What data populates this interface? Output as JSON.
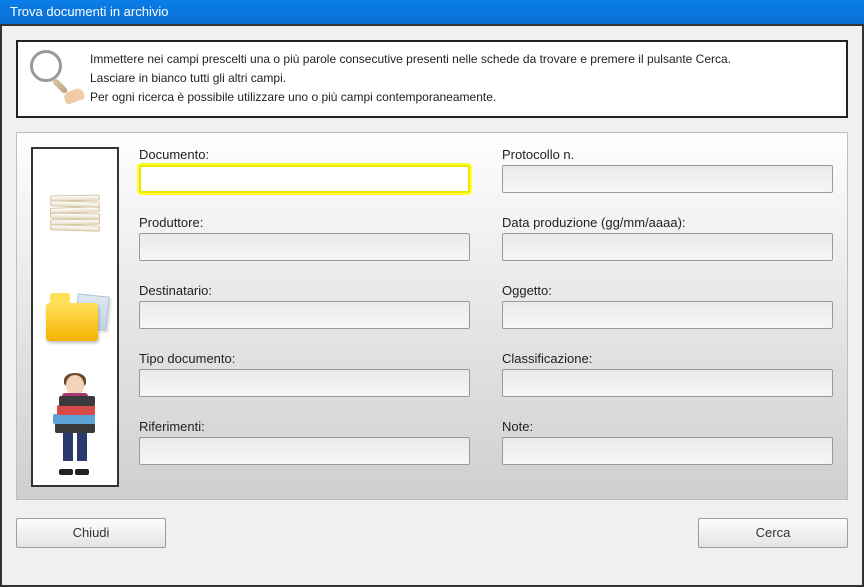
{
  "window": {
    "title": "Trova documenti in archivio"
  },
  "help": {
    "line1": "Immettere nei campi prescelti una o più parole consecutive presenti nelle schede da trovare e premere il pulsante Cerca.",
    "line2": "Lasciare in bianco tutti gli altri campi.",
    "line3": "Per ogni ricerca è possibile utilizzare uno o più campi contemporaneamente."
  },
  "fields": {
    "documento": {
      "label": "Documento:",
      "value": ""
    },
    "protocollo": {
      "label": "Protocollo n.",
      "value": ""
    },
    "produttore": {
      "label": "Produttore:",
      "value": ""
    },
    "data_produzione": {
      "label": "Data produzione (gg/mm/aaaa):",
      "value": ""
    },
    "destinatario": {
      "label": "Destinatario:",
      "value": ""
    },
    "oggetto": {
      "label": "Oggetto:",
      "value": ""
    },
    "tipo_documento": {
      "label": "Tipo documento:",
      "value": ""
    },
    "classificazione": {
      "label": "Classificazione:",
      "value": ""
    },
    "riferimenti": {
      "label": "Riferimenti:",
      "value": ""
    },
    "note": {
      "label": "Note:",
      "value": ""
    }
  },
  "buttons": {
    "chiudi": "Chiudi",
    "cerca": "Cerca"
  }
}
